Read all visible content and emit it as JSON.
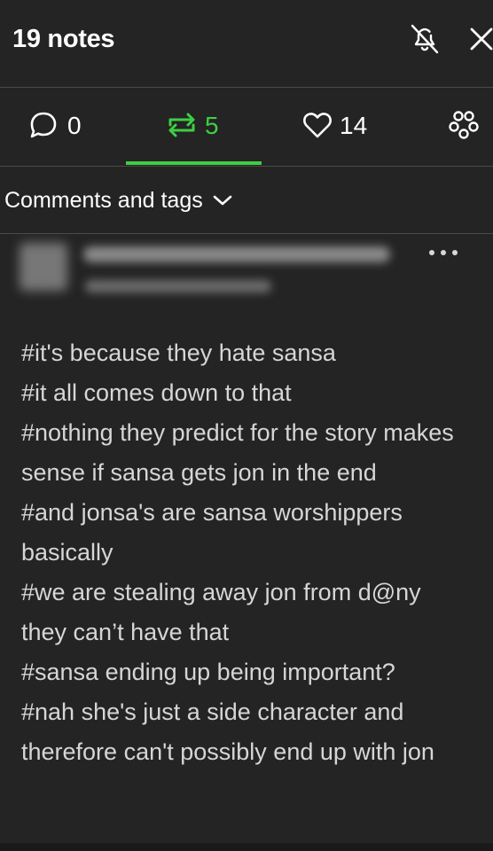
{
  "header": {
    "title": "19 notes",
    "mute_icon": "bell-slash-icon",
    "close_icon": "close-icon"
  },
  "tabs": [
    {
      "icon": "comment-icon",
      "count": "0"
    },
    {
      "icon": "reblog-icon",
      "count": "5",
      "active": true
    },
    {
      "icon": "heart-icon",
      "count": "14"
    },
    {
      "icon": "community-icon"
    }
  ],
  "filter": {
    "label": "Comments and tags",
    "icon": "chevron-down-icon"
  },
  "note": {
    "tags": [
      "#it's because they hate sansa",
      "#it all comes down to that",
      "#nothing they predict for the story makes sense if sansa gets jon in the end",
      "#and jonsa's are sansa worshippers basically",
      "#we are stealing away jon from d@ny they can’t have that",
      "#sansa ending up being important?",
      "#nah she's just a side character and therefore can't possibly end up with jon"
    ]
  },
  "colors": {
    "background": "#242424",
    "accent_green": "#3ece43",
    "divider": "#4a4a4a",
    "tag_text": "#d6d6d6"
  }
}
